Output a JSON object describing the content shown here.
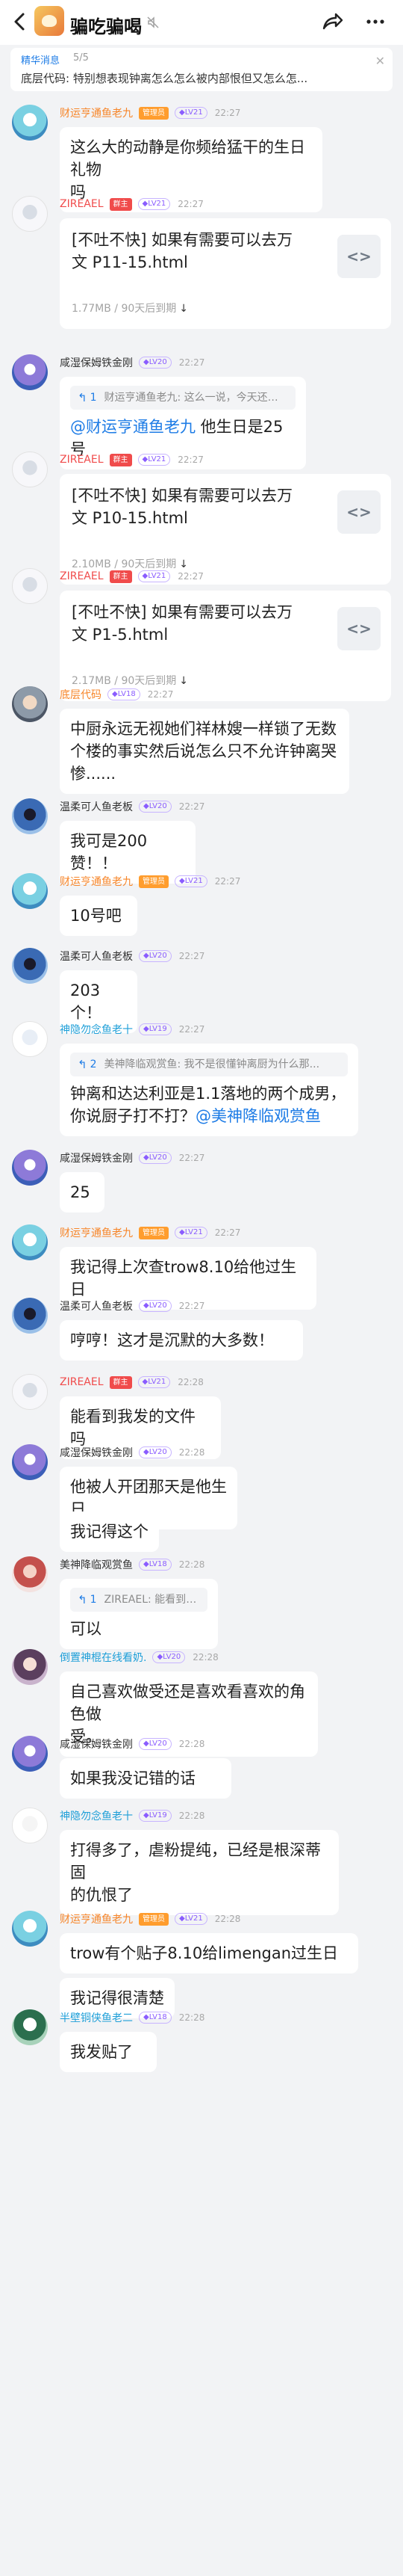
{
  "header": {
    "back_icon": "chevron-left-icon",
    "group_name": "骗吃骗喝",
    "share_icon": "share-icon",
    "more_icon": "more-dots-icon"
  },
  "pinned": {
    "label": "精华消息",
    "count": "5/5",
    "text": "底层代码: 特别想表现钟离怎么怎么被内部恨但又怎么怎..."
  },
  "messages": [
    {
      "name": "财运亨通鱼老九",
      "name_color": "#f7862a",
      "badge": "管理员",
      "badge_color": "#ff9d2e",
      "level": "LV21",
      "time": "22:27",
      "lines": [
        "这么大的动静是你频给猛干的生日礼物",
        "吗"
      ]
    },
    {
      "name": "ZIREAEL",
      "name_color": "#f04b4b",
      "badge": "群主",
      "badge_color": "#f04b4b",
      "level": "LV21",
      "time": "22:27",
      "file": {
        "lines": [
          "[不吐不快] 如果有需要可以去万",
          "文 P11-15.html"
        ],
        "size": "1.77MB / 90天后到期",
        "download": "↓"
      }
    },
    {
      "name": "咸湿保姆铁金刚",
      "name_color": "#333333",
      "level": "LV20",
      "time": "22:27",
      "quote": {
        "num": "1",
        "text": "财运亨通鱼老九: 这么一说，今天还是李瑞于..."
      },
      "mention": "@财运亨通鱼老九",
      "tail": " 他生日是25号"
    },
    {
      "name": "ZIREAEL",
      "name_color": "#f04b4b",
      "badge": "群主",
      "badge_color": "#f04b4b",
      "level": "LV21",
      "time": "22:27",
      "file": {
        "lines": [
          "[不吐不快] 如果有需要可以去万",
          "文 P10-15.html"
        ],
        "size": "2.10MB / 90天后到期",
        "download": "↓"
      }
    },
    {
      "name": "ZIREAEL",
      "name_color": "#f04b4b",
      "badge": "群主",
      "badge_color": "#f04b4b",
      "level": "LV21",
      "time": "22:27",
      "file": {
        "lines": [
          "[不吐不快] 如果有需要可以去万",
          "文 P1-5.html"
        ],
        "size": "2.17MB / 90天后到期",
        "download": "↓"
      }
    },
    {
      "name": "底层代码",
      "name_color": "#f7862a",
      "level": "LV18",
      "time": "22:27",
      "lines": [
        "中厨永远无视她们祥林嫂一样锁了无数",
        "个楼的事实然后说怎么只不允许钟离哭",
        "惨......"
      ]
    },
    {
      "name": "温柔可人鱼老板",
      "name_color": "#333333",
      "level": "LV20",
      "time": "22:27",
      "lines": [
        "我可是200赞！！"
      ]
    },
    {
      "name": "财运亨通鱼老九",
      "name_color": "#f7862a",
      "badge": "管理员",
      "badge_color": "#ff9d2e",
      "level": "LV21",
      "time": "22:27",
      "lines": [
        "10号吧"
      ]
    },
    {
      "name": "温柔可人鱼老板",
      "name_color": "#333333",
      "level": "LV20",
      "time": "22:27",
      "lines": [
        "203个！"
      ]
    },
    {
      "name": "神隐勿念鱼老十",
      "name_color": "#1e9fd8",
      "level": "LV19",
      "time": "22:27",
      "quote": {
        "num": "2",
        "text": "美神降临观赏鱼: 我不是很懂钟离厨为什么那..."
      },
      "lines": [
        "钟离和达达利亚是1.1落地的两个成男，"
      ],
      "mention_line": {
        "prefix": "你说厨子打不打？",
        "mention": "@美神降临观赏鱼"
      }
    },
    {
      "name": "咸湿保姆铁金刚",
      "name_color": "#333333",
      "level": "LV20",
      "time": "22:27",
      "lines": [
        "25"
      ]
    },
    {
      "name": "财运亨通鱼老九",
      "name_color": "#f7862a",
      "badge": "管理员",
      "badge_color": "#ff9d2e",
      "level": "LV21",
      "time": "22:27",
      "lines": [
        "我记得上次查trow8.10给他过生日"
      ]
    },
    {
      "name": "温柔可人鱼老板",
      "name_color": "#333333",
      "level": "LV20",
      "time": "22:27",
      "lines": [
        "哼哼！这才是沉默的大多数！"
      ]
    },
    {
      "name": "ZIREAEL",
      "name_color": "#f04b4b",
      "badge": "群主",
      "badge_color": "#f04b4b",
      "level": "LV21",
      "time": "22:28",
      "lines": [
        "能看到我发的文件吗"
      ]
    },
    {
      "name": "咸湿保姆铁金刚",
      "name_color": "#333333",
      "level": "LV20",
      "time": "22:28",
      "lines": [
        "他被人开团那天是他生日"
      ],
      "extra": "我记得这个"
    },
    {
      "name": "美神降临观赏鱼",
      "name_color": "#333333",
      "level": "LV18",
      "time": "22:28",
      "quote": {
        "num": "1",
        "text": "ZIREAEL: 能看到我发的文件吗"
      },
      "lines": [
        "可以"
      ]
    },
    {
      "name": "倒置神棍在线看奶.",
      "name_color": "#1e9fd8",
      "level": "LV20",
      "time": "22:28",
      "lines": [
        "自己喜欢做受还是喜欢看喜欢的角色做",
        "受。"
      ]
    },
    {
      "name": "咸湿保姆铁金刚",
      "name_color": "#333333",
      "level": "LV20",
      "time": "22:28",
      "lines": [
        "如果我没记错的话"
      ]
    },
    {
      "name": "神隐勿念鱼老十",
      "name_color": "#1e9fd8",
      "level": "LV19",
      "time": "22:28",
      "lines": [
        "打得多了，虐粉提纯，已经是根深蒂固",
        "的仇恨了"
      ]
    },
    {
      "name": "财运亨通鱼老九",
      "name_color": "#f7862a",
      "badge": "管理员",
      "badge_color": "#ff9d2e",
      "level": "LV21",
      "time": "22:28",
      "lines": [
        "trow有个贴子8.10给limengan过生日"
      ],
      "extra": "我记得很清楚"
    },
    {
      "name": "半壁铜侠鱼老二",
      "name_color": "#1e9fd8",
      "level": "LV18",
      "time": "22:28",
      "lines": [
        "我发贴了"
      ]
    }
  ]
}
